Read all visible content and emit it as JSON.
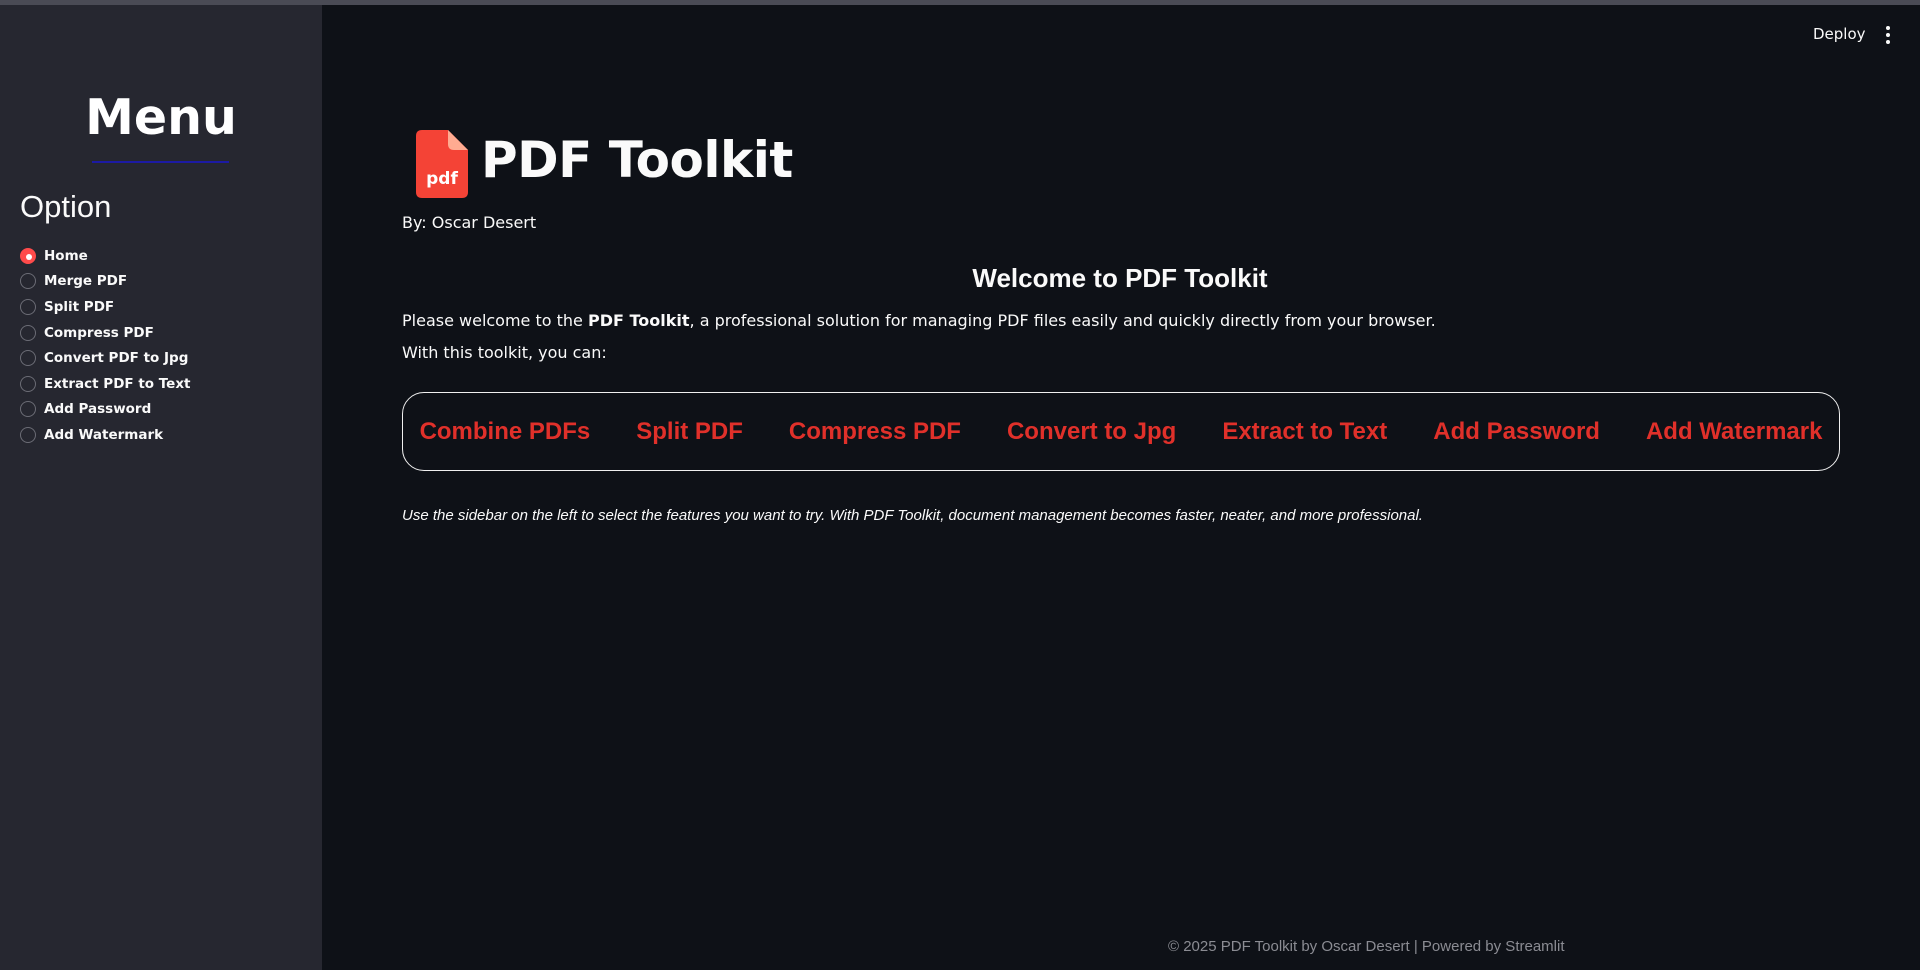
{
  "sidebar": {
    "title": "Menu",
    "option_label": "Option",
    "items": [
      {
        "label": "Home",
        "selected": true
      },
      {
        "label": "Merge PDF",
        "selected": false
      },
      {
        "label": "Split PDF",
        "selected": false
      },
      {
        "label": "Compress PDF",
        "selected": false
      },
      {
        "label": "Convert PDF to Jpg",
        "selected": false
      },
      {
        "label": "Extract PDF to Text",
        "selected": false
      },
      {
        "label": "Add Password",
        "selected": false
      },
      {
        "label": "Add Watermark",
        "selected": false
      }
    ]
  },
  "header": {
    "deploy_label": "Deploy",
    "menu_icon": "kebab-menu-icon"
  },
  "main": {
    "icon_label": "pdf",
    "icon": "pdf-file-icon",
    "title": "PDF Toolkit",
    "byline": "By: Oscar Desert",
    "welcome_heading": "Welcome to PDF Toolkit",
    "intro_prefix": "Please welcome to the ",
    "intro_bold": "PDF Toolkit",
    "intro_suffix": ", a professional solution for managing PDF files easily and quickly directly from your browser.",
    "with_text": "With this toolkit, you can:",
    "features": [
      "Combine PDFs",
      "Split PDF",
      "Compress PDF",
      "Convert to Jpg",
      "Extract to Text",
      "Add Password",
      "Add Watermark"
    ],
    "note": "Use the sidebar on the left to select the features you want to try. With PDF Toolkit, document management becomes faster, neater, and more professional."
  },
  "footer": {
    "text": "© 2025 PDF Toolkit by Oscar Desert | Powered by Streamlit"
  },
  "colors": {
    "background": "#0e1117",
    "sidebar": "#262730",
    "accent": "#ff4b4b",
    "feature_text": "#e0302a",
    "pdf_icon": "#f44336"
  }
}
